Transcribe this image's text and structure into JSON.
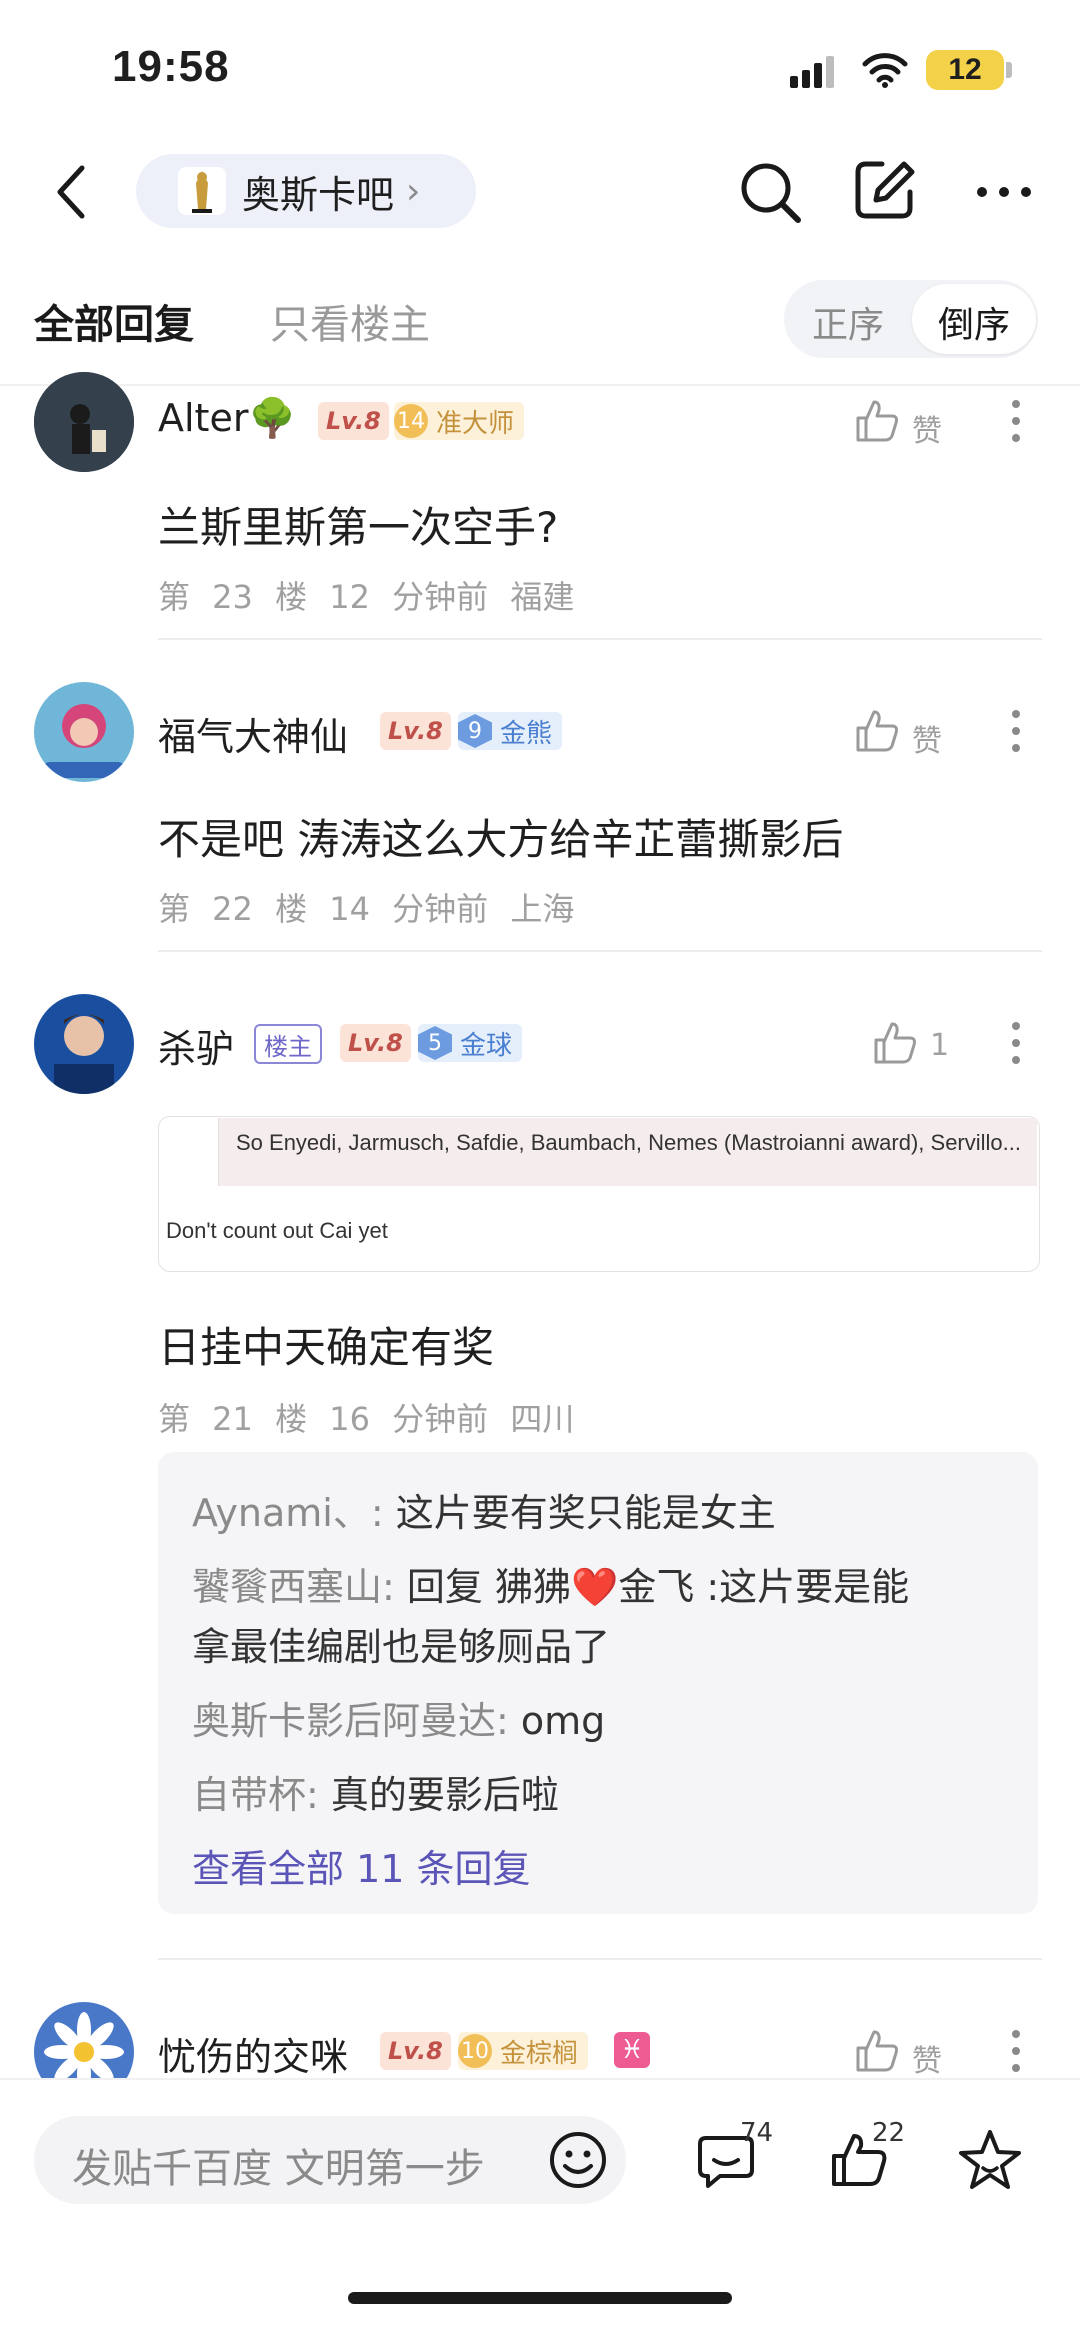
{
  "status": {
    "time": "19:58",
    "battery": "12"
  },
  "header": {
    "forum_name": "奥斯卡吧"
  },
  "tabs": {
    "all": "全部回复",
    "owner_only": "只看楼主"
  },
  "sort": {
    "asc": "正序",
    "desc": "倒序"
  },
  "posts": [
    {
      "username": "Alter🌳",
      "level": "Lv.8",
      "badge_num": "14",
      "badge_label": "准大师",
      "like_label": "赞",
      "content": "兰斯里斯第一次空手?",
      "floor": "第 23 楼",
      "time": "12 分钟前",
      "location": "福建"
    },
    {
      "username": "福气大神仙",
      "level": "Lv.8",
      "badge_num": "9",
      "badge_label": "金熊",
      "like_label": "赞",
      "content": "不是吧 涛涛这么大方给辛芷蕾撕影后",
      "floor": "第 22 楼",
      "time": "14 分钟前",
      "location": "上海"
    },
    {
      "username": "杀驴",
      "owner_tag": "楼主",
      "level": "Lv.8",
      "badge_num": "5",
      "badge_label": "金球",
      "like_count": "1",
      "quote_text": "So Enyedi, Jarmusch, Safdie, Baumbach, Nemes (Mastroianni award), Servillo...",
      "quote_reply": "Don't count out Cai yet",
      "content": "日挂中天确定有奖",
      "floor": "第 21 楼",
      "time": "16 分钟前",
      "location": "四川",
      "replies": [
        {
          "who": "Aynami、:",
          "text": "这片要有奖只能是女主"
        },
        {
          "who": "饕餮西塞山:",
          "text": "回复 狒狒❤️金飞 :这片要是能",
          "text2": "拿最佳编剧也是够厕品了"
        },
        {
          "who": "奥斯卡影后阿曼达:",
          "text": "omg"
        },
        {
          "who": "自带杯:",
          "text": "真的要影后啦"
        }
      ],
      "more_replies": "查看全部 11 条回复"
    },
    {
      "username": "忧伤的交咪",
      "level": "Lv.8",
      "badge_num": "10",
      "badge_label": "金棕榈",
      "zodiac": "♓",
      "like_label": "赞"
    }
  ],
  "bottom": {
    "placeholder": "发贴千百度 文明第一步",
    "comment_count": "74",
    "like_count": "22"
  },
  "colors": {
    "accent": "#5b55b8",
    "level_bg": "#fbe3d8",
    "gold_badge": "#f1be57",
    "blue_badge": "#6d9be0"
  }
}
